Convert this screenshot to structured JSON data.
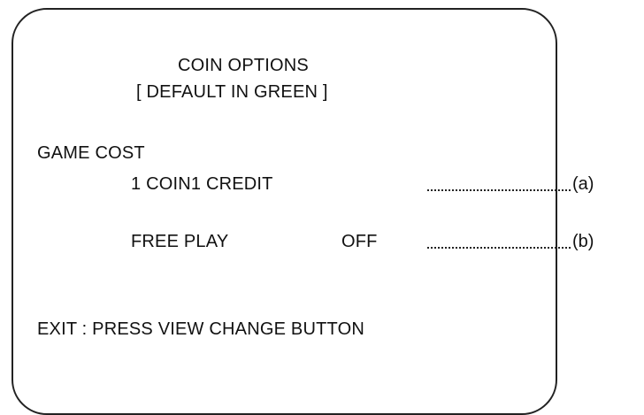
{
  "screen": {
    "title": "COIN OPTIONS",
    "subtitle": "[ DEFAULT IN GREEN ]",
    "section_label": "GAME COST",
    "options": [
      {
        "label": "1 COIN1 CREDIT",
        "value": "",
        "callout": "(a)"
      },
      {
        "label": "FREE PLAY",
        "value": "OFF",
        "callout": "(b)"
      }
    ],
    "exit_instruction": "EXIT : PRESS VIEW CHANGE BUTTON"
  }
}
